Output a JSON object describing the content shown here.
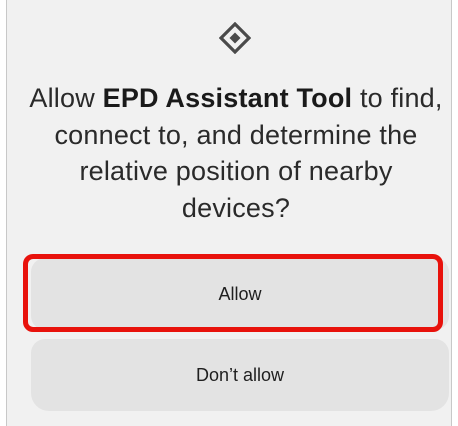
{
  "icon": {
    "name": "nearby-devices-icon",
    "color": "#4a4a4a"
  },
  "message": {
    "prefix": "Allow ",
    "app_name": "EPD Assistant Tool",
    "suffix": " to find, connect to, and determine the relative position of nearby devices?"
  },
  "buttons": {
    "allow_label": "Allow",
    "deny_label": "Don’t allow"
  },
  "highlight": {
    "target": "allow",
    "color": "#e8120c"
  }
}
